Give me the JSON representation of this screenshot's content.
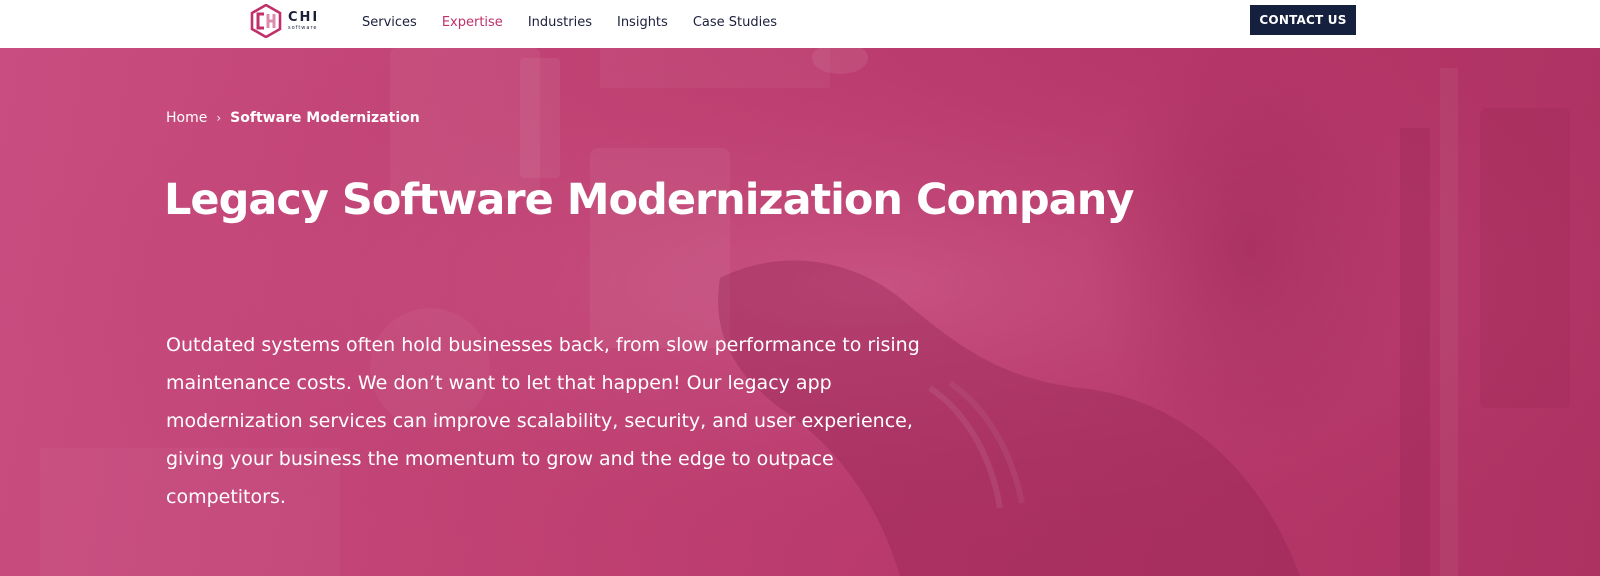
{
  "colors": {
    "brand_pink": "#c0306a",
    "hero_overlay": "#bd3f70",
    "navy": "#15203f",
    "nav_text": "#1b1f3b",
    "white": "#ffffff"
  },
  "header": {
    "logo": {
      "name": "CHI",
      "sub": "software",
      "icon": "chi-logo-icon"
    },
    "nav": [
      {
        "label": "Services",
        "active": false
      },
      {
        "label": "Expertise",
        "active": true
      },
      {
        "label": "Industries",
        "active": false
      },
      {
        "label": "Insights",
        "active": false
      },
      {
        "label": "Case Studies",
        "active": false
      }
    ],
    "contact_label": "CONTACT US"
  },
  "hero": {
    "breadcrumb": {
      "home": "Home",
      "separator": "›",
      "current": "Software Modernization"
    },
    "title": "Legacy Software Modernization Company",
    "description": "Outdated systems often hold businesses back, from slow performance to rising maintenance costs. We don’t want to let that happen! Our legacy app modernization services can improve scalability, security, and user experience, giving your business the momentum to grow and the edge to outpace competitors."
  }
}
